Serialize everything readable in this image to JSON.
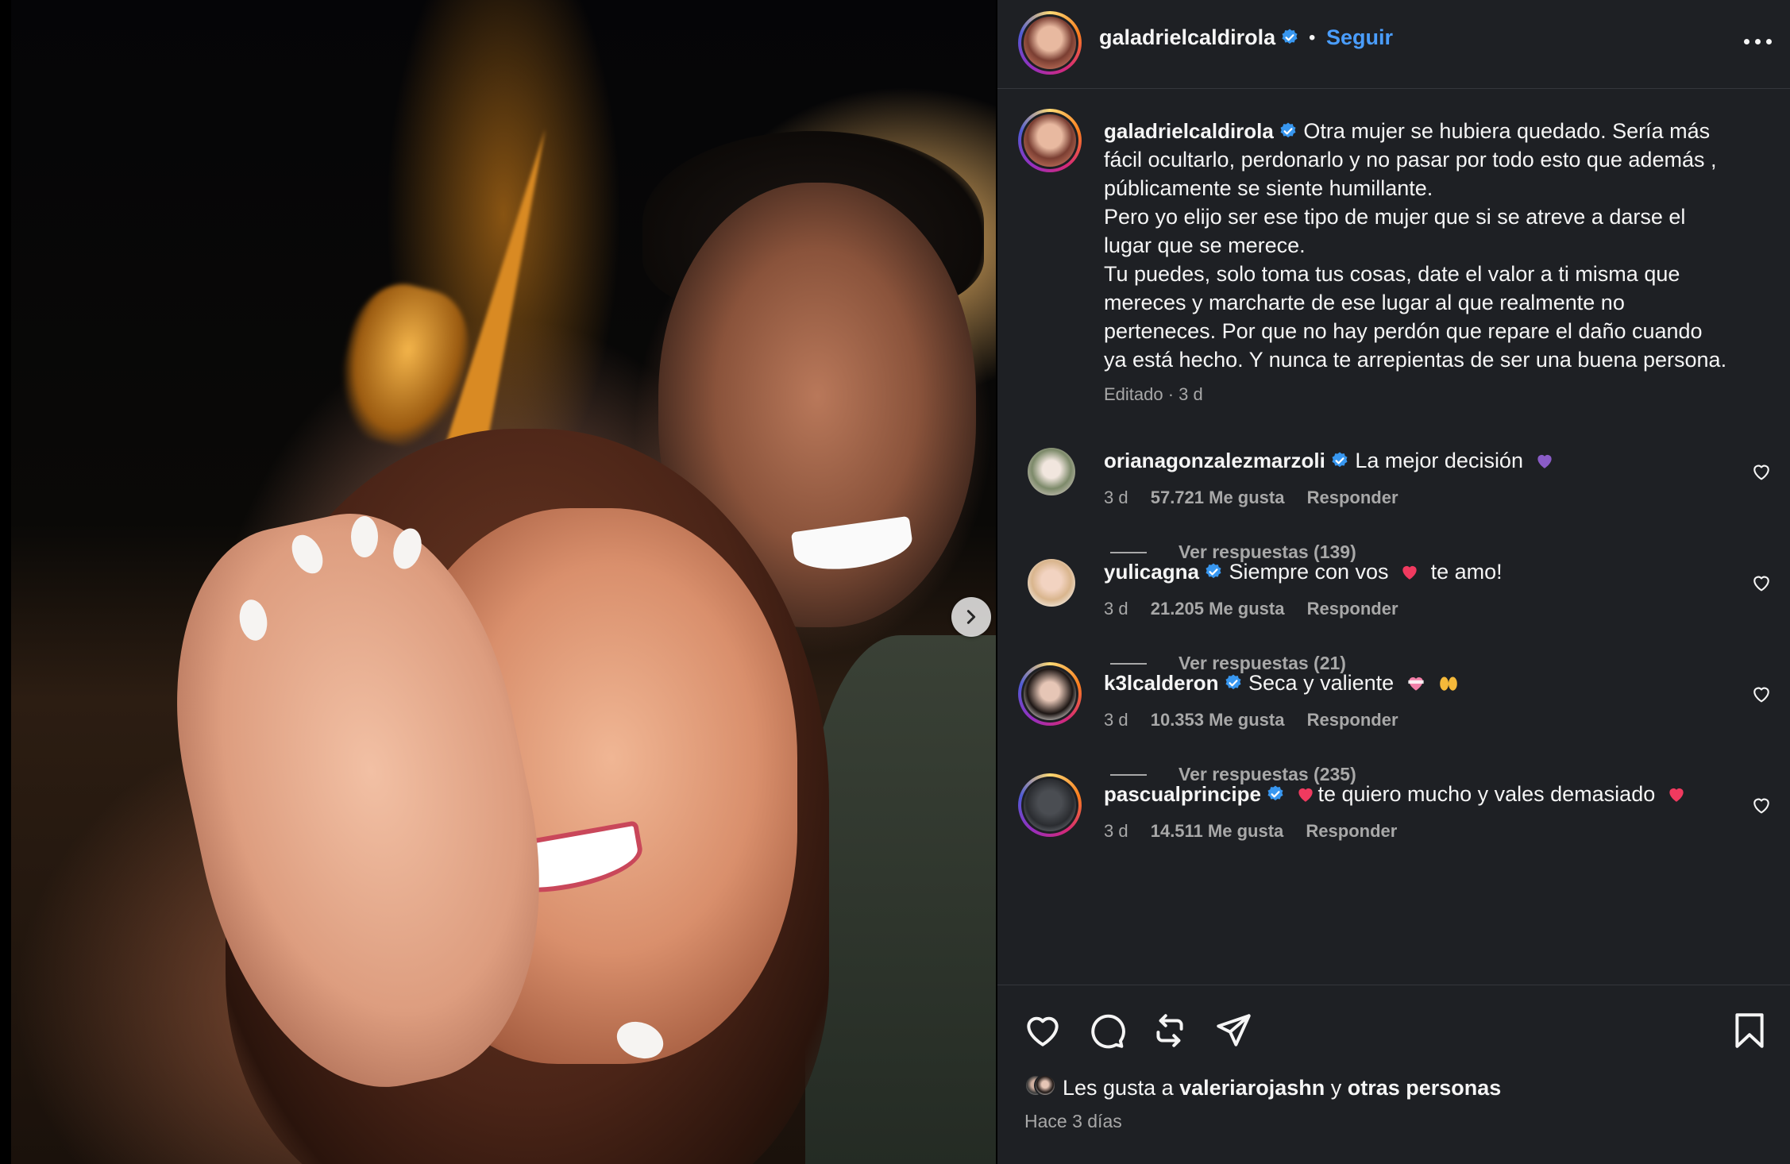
{
  "post": {
    "author": "galadrielcaldirola",
    "follow_label": "Seguir",
    "header_separator": "•",
    "caption": [
      "Otra mujer se hubiera quedado. Sería más",
      "fácil ocultarlo, perdonarlo y no pasar por todo esto que además ,",
      "públicamente se siente humillante.",
      "Pero yo elijo ser ese tipo de mujer que si se atreve a darse el",
      "lugar que se merece.",
      "Tu puedes, solo toma tus cosas, date el valor a ti misma que",
      "mereces y marcharte de ese lugar al que realmente no",
      "perteneces. Por que no hay perdón que repare el daño cuando",
      "ya está hecho. Y nunca te arrepientas de ser una buena persona."
    ],
    "caption_meta": "Editado · 3 d"
  },
  "comments": [
    {
      "user": "orianagonzalezmarzoli",
      "text": "La mejor decisión",
      "emoji_after": [
        "purple-heart-emoji"
      ],
      "time": "3 d",
      "likes": "57.721 Me gusta",
      "reply_label": "Responder",
      "replies": "Ver respuestas (139)"
    },
    {
      "user": "yulicagna",
      "text": "Siempre con vos",
      "emoji_after": [
        "red-heart-emoji"
      ],
      "text_after": "te amo!",
      "time": "3 d",
      "likes": "21.205 Me gusta",
      "reply_label": "Responder",
      "replies": "Ver respuestas (21)"
    },
    {
      "user": "k3lcalderon",
      "text": "Seca y valiente",
      "emoji_after": [
        "heart-ribbon-emoji",
        "raising-hands-emoji"
      ],
      "time": "3 d",
      "likes": "10.353 Me gusta",
      "reply_label": "Responder",
      "replies": "Ver respuestas (235)"
    },
    {
      "user": "pascualprincipe",
      "emoji_before": [
        "red-heart-emoji"
      ],
      "text": "te quiero mucho y vales demasiado",
      "emoji_after": [
        "red-heart-emoji"
      ],
      "time": "3 d",
      "likes": "14.511 Me gusta",
      "reply_label": "Responder"
    }
  ],
  "liked_by": {
    "prefix": "Les gusta a",
    "user": "valeriarojashn",
    "connector": "y",
    "others": "otras personas"
  },
  "timestamp": "Hace 3 días",
  "icons": {
    "verified": "verified-badge-icon",
    "more": "more-options-icon",
    "next": "chevron-right-icon",
    "like": "heart-icon",
    "comment": "comment-bubble-icon",
    "repost": "repost-icon",
    "share": "share-send-icon",
    "save": "bookmark-icon"
  },
  "colors": {
    "panel_bg": "#1e2024",
    "link_blue": "#4a9dfd",
    "verified_blue": "#3897f0",
    "muted_text": "#a8a8a8"
  }
}
